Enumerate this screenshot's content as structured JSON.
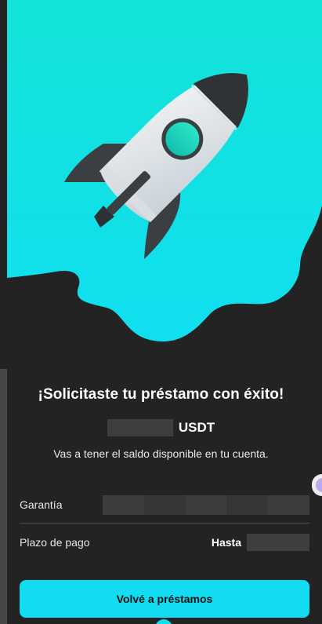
{
  "hero": {
    "illustration": "rocket-illustration",
    "colors": {
      "sky": "#12e2d6",
      "background": "#232323"
    }
  },
  "success": {
    "title": "¡Solicitaste tu préstamo con éxito!",
    "amount_currency": "USDT",
    "subtitle": "Vas a tener el saldo disponible en tu cuenta."
  },
  "details": {
    "guarantee_label": "Garantía",
    "term_label": "Plazo de pago",
    "term_prefix": "Hasta"
  },
  "actions": {
    "back_label": "Volvé a préstamos"
  },
  "colors": {
    "accent": "#11dcf1",
    "panel": "#232323"
  }
}
